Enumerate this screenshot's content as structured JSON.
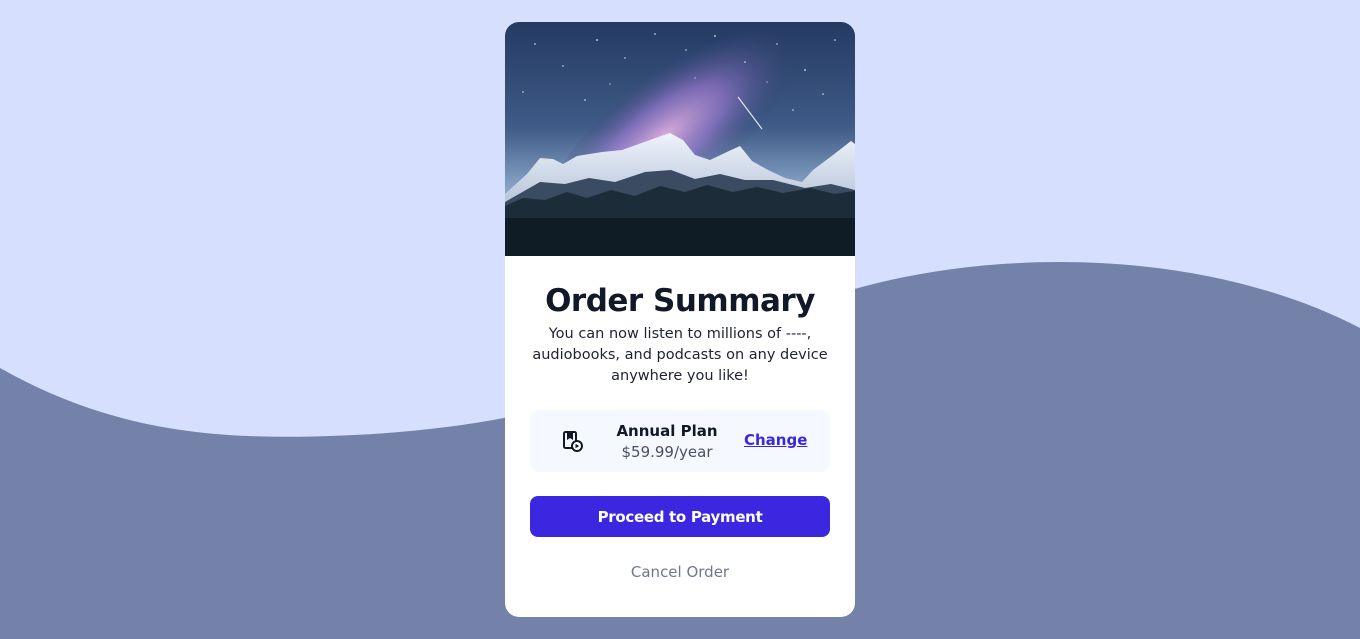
{
  "background": {
    "light_color": "#d6e0fe",
    "wave_color": "#7481a8"
  },
  "hero": {
    "icon": "mountain-night-sky-illustration"
  },
  "card": {
    "title": "Order Summary",
    "subtitle": "You can now listen to millions of ----, audiobooks, and podcasts on any device anywhere you like!",
    "plan": {
      "icon": "music-icon",
      "name": "Annual Plan",
      "price": "$59.99/year",
      "change_label": "Change"
    },
    "proceed_label": "Proceed to Payment",
    "cancel_label": "Cancel Order",
    "accent_color": "#3b27e0"
  }
}
